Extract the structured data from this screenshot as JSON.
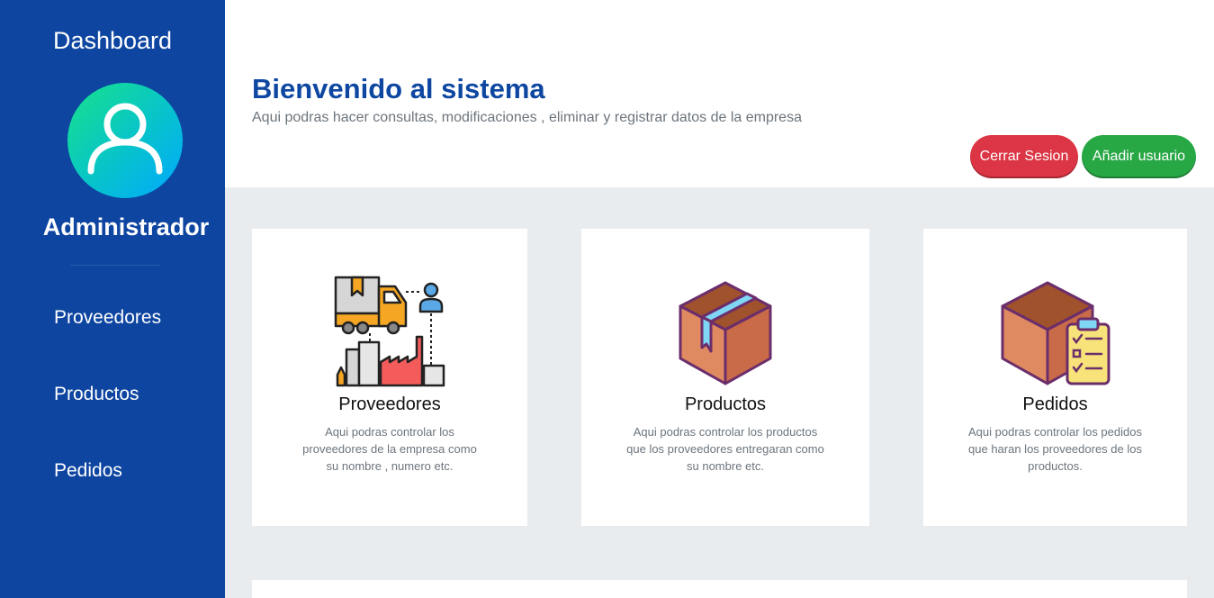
{
  "sidebar": {
    "title": "Dashboard",
    "avatar_icon": "user-icon",
    "role": "Administrador",
    "items": [
      {
        "label": "Proveedores"
      },
      {
        "label": "Productos"
      },
      {
        "label": "Pedidos"
      }
    ]
  },
  "header": {
    "title": "Bienvenido al sistema",
    "subtitle": "Aqui podras hacer consultas, modificaciones , eliminar y registrar datos de la empresa",
    "logout_label": "Cerrar Sesion",
    "add_user_label": "Añadir usuario"
  },
  "cards": [
    {
      "icon": "supplier-truck-factory-icon",
      "title": "Proveedores",
      "description": "Aqui podras controlar los proveedores de la empresa como su nombre , numero etc."
    },
    {
      "icon": "box-icon",
      "title": "Productos",
      "description": "Aqui podras controlar los productos que los proveedores entregaran como su nombre etc."
    },
    {
      "icon": "box-clipboard-icon",
      "title": "Pedidos",
      "description": "Aqui podras controlar los pedidos que haran los proveedores de los productos."
    }
  ],
  "colors": {
    "sidebar": "#0d45a0",
    "title": "#0d47a1",
    "danger": "#dc3545",
    "success": "#28a745",
    "background": "#e9ecef"
  }
}
